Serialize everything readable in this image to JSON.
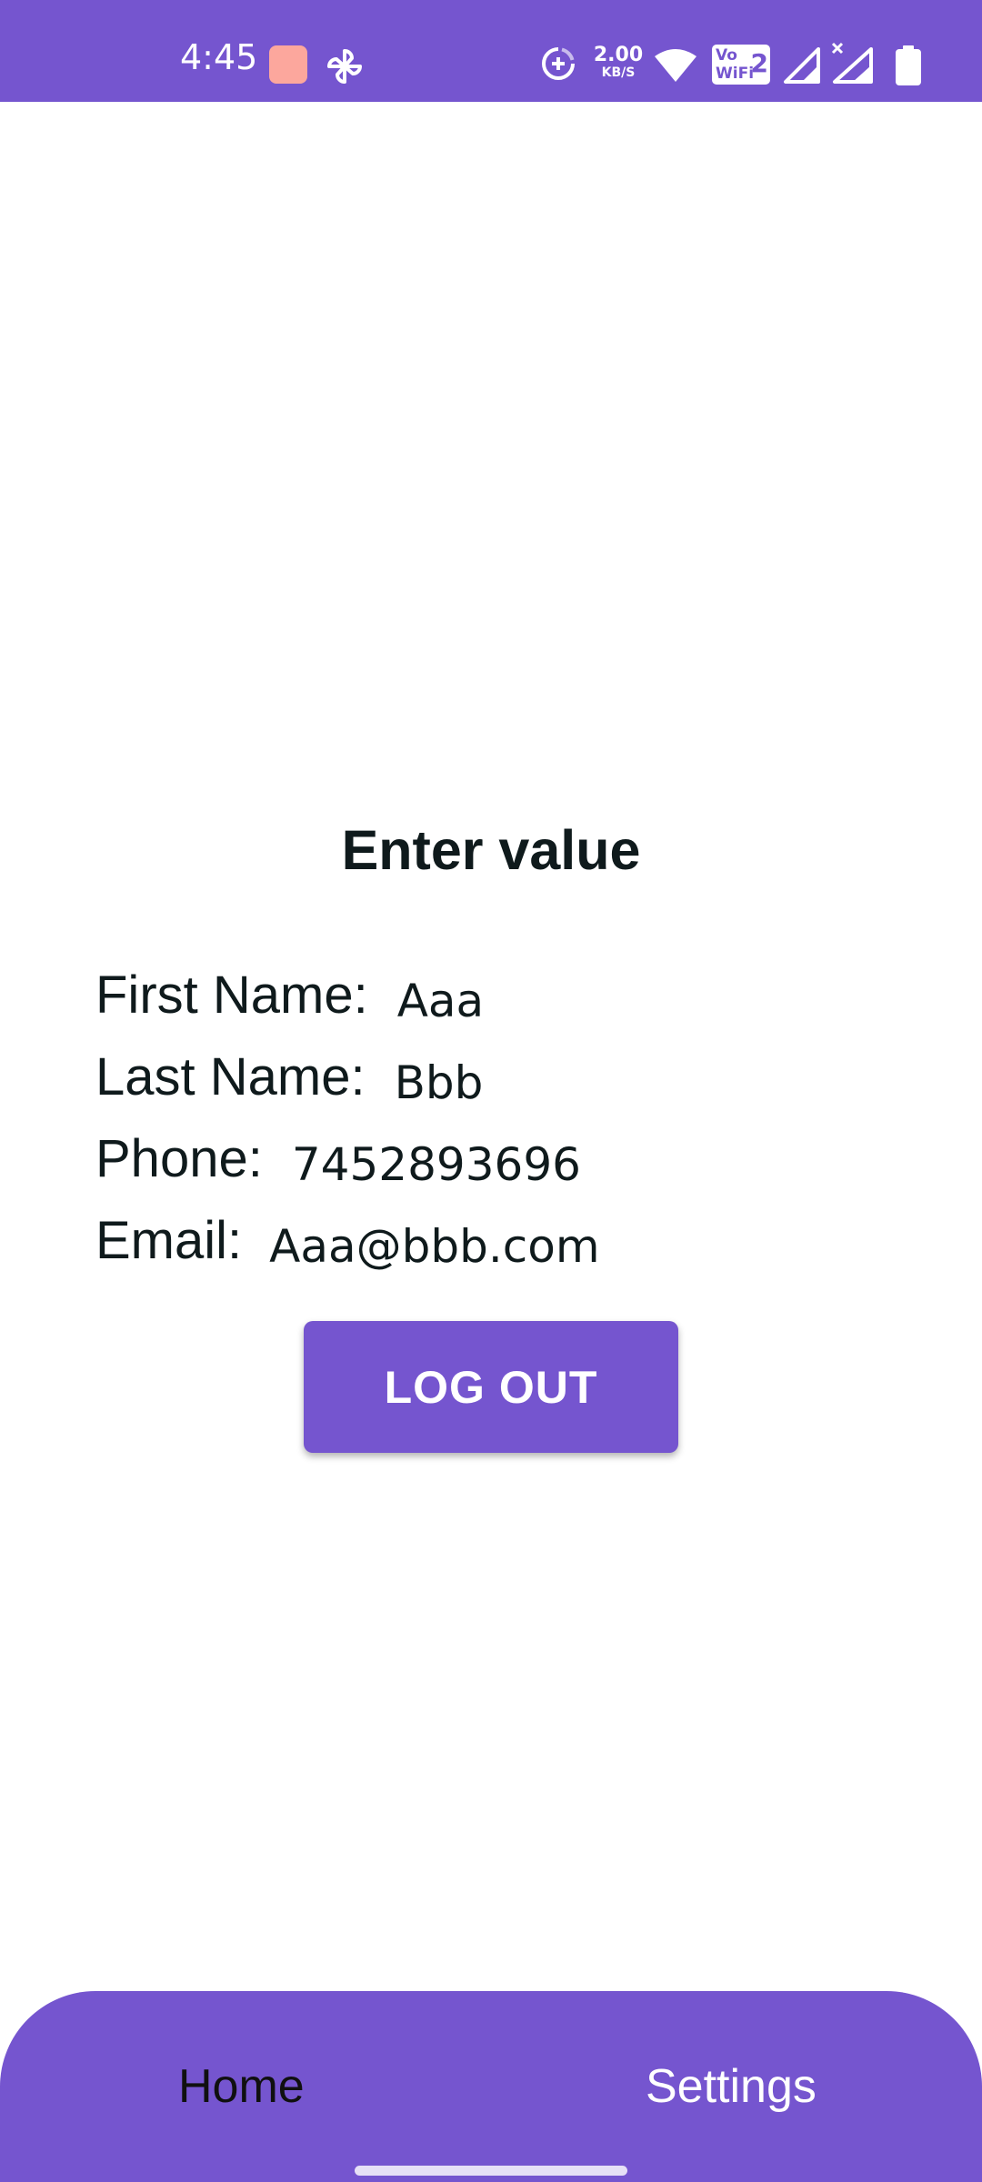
{
  "status_bar": {
    "time": "4:45",
    "net_speed_value": "2.00",
    "net_speed_unit": "KB/S",
    "vowifi_text": "Vo WiFi",
    "vowifi_slot": "2",
    "icons": [
      "app-notification-icon",
      "pinwheel-icon",
      "data-saver-icon",
      "wifi-icon",
      "vowifi-icon",
      "signal-icon",
      "signal-no-data-icon",
      "battery-icon"
    ],
    "background_color": "#7555cf"
  },
  "main": {
    "title": "Enter value",
    "fields": [
      {
        "label": "First Name:",
        "value": "Aaa"
      },
      {
        "label": "Last Name:",
        "value": "Bbb"
      },
      {
        "label": "Phone:",
        "value": "7452893696"
      },
      {
        "label": "Email:",
        "value": "Aaa@bbb.com"
      }
    ],
    "logout_label": "LOG OUT"
  },
  "bottom_nav": {
    "items": [
      {
        "label": "Home",
        "selected": true
      },
      {
        "label": "Settings",
        "selected": false
      }
    ]
  },
  "colors": {
    "accent": "#7555cf",
    "text": "#0f1a1c",
    "on_accent": "#ffffff"
  }
}
